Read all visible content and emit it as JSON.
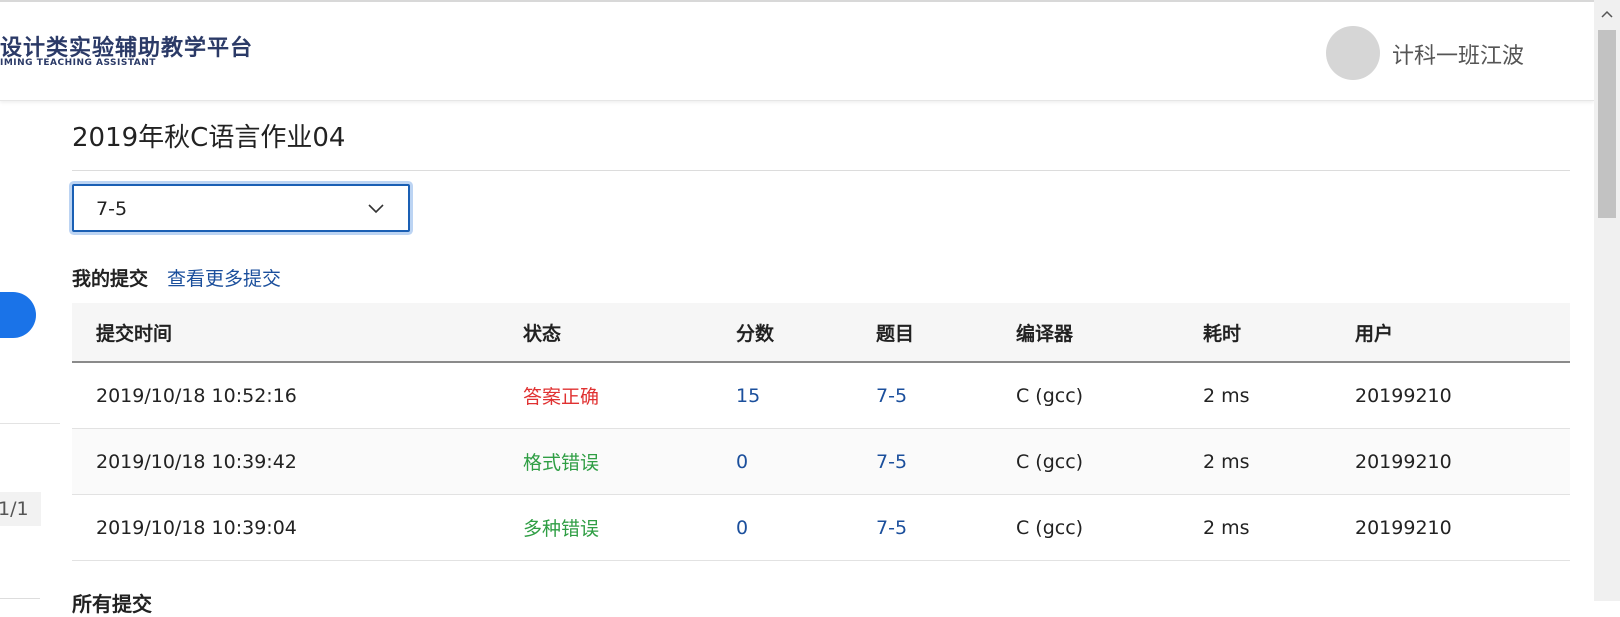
{
  "header": {
    "logo_title": "设计类实验辅助教学平台",
    "logo_subtitle": "IMING TEACHING ASSISTANT",
    "username": "计科一班江波"
  },
  "sidebar": {
    "pagination": "1/1"
  },
  "main": {
    "title": "2019年秋C语言作业04",
    "problem_select": {
      "value": "7-5",
      "icon": "chevron-down-icon"
    },
    "my_submissions_label": "我的提交",
    "more_submissions_link": "查看更多提交",
    "all_submissions_label": "所有提交"
  },
  "table": {
    "headers": [
      "提交时间",
      "状态",
      "分数",
      "题目",
      "编译器",
      "耗时",
      "用户"
    ],
    "rows": [
      [
        "2019/10/18 10:52:16",
        "答案正确",
        "15",
        "7-5",
        "C (gcc)",
        "2 ms",
        "20199210"
      ],
      [
        "2019/10/18 10:39:42",
        "格式错误",
        "0",
        "7-5",
        "C (gcc)",
        "2 ms",
        "20199210"
      ],
      [
        "2019/10/18 10:39:04",
        "多种错误",
        "0",
        "7-5",
        "C (gcc)",
        "2 ms",
        "20199210"
      ]
    ]
  },
  "colors": {
    "accent": "#1a73e8",
    "link": "#1b4f9c",
    "status_correct": "#e03131",
    "status_error": "#2f9e44"
  }
}
